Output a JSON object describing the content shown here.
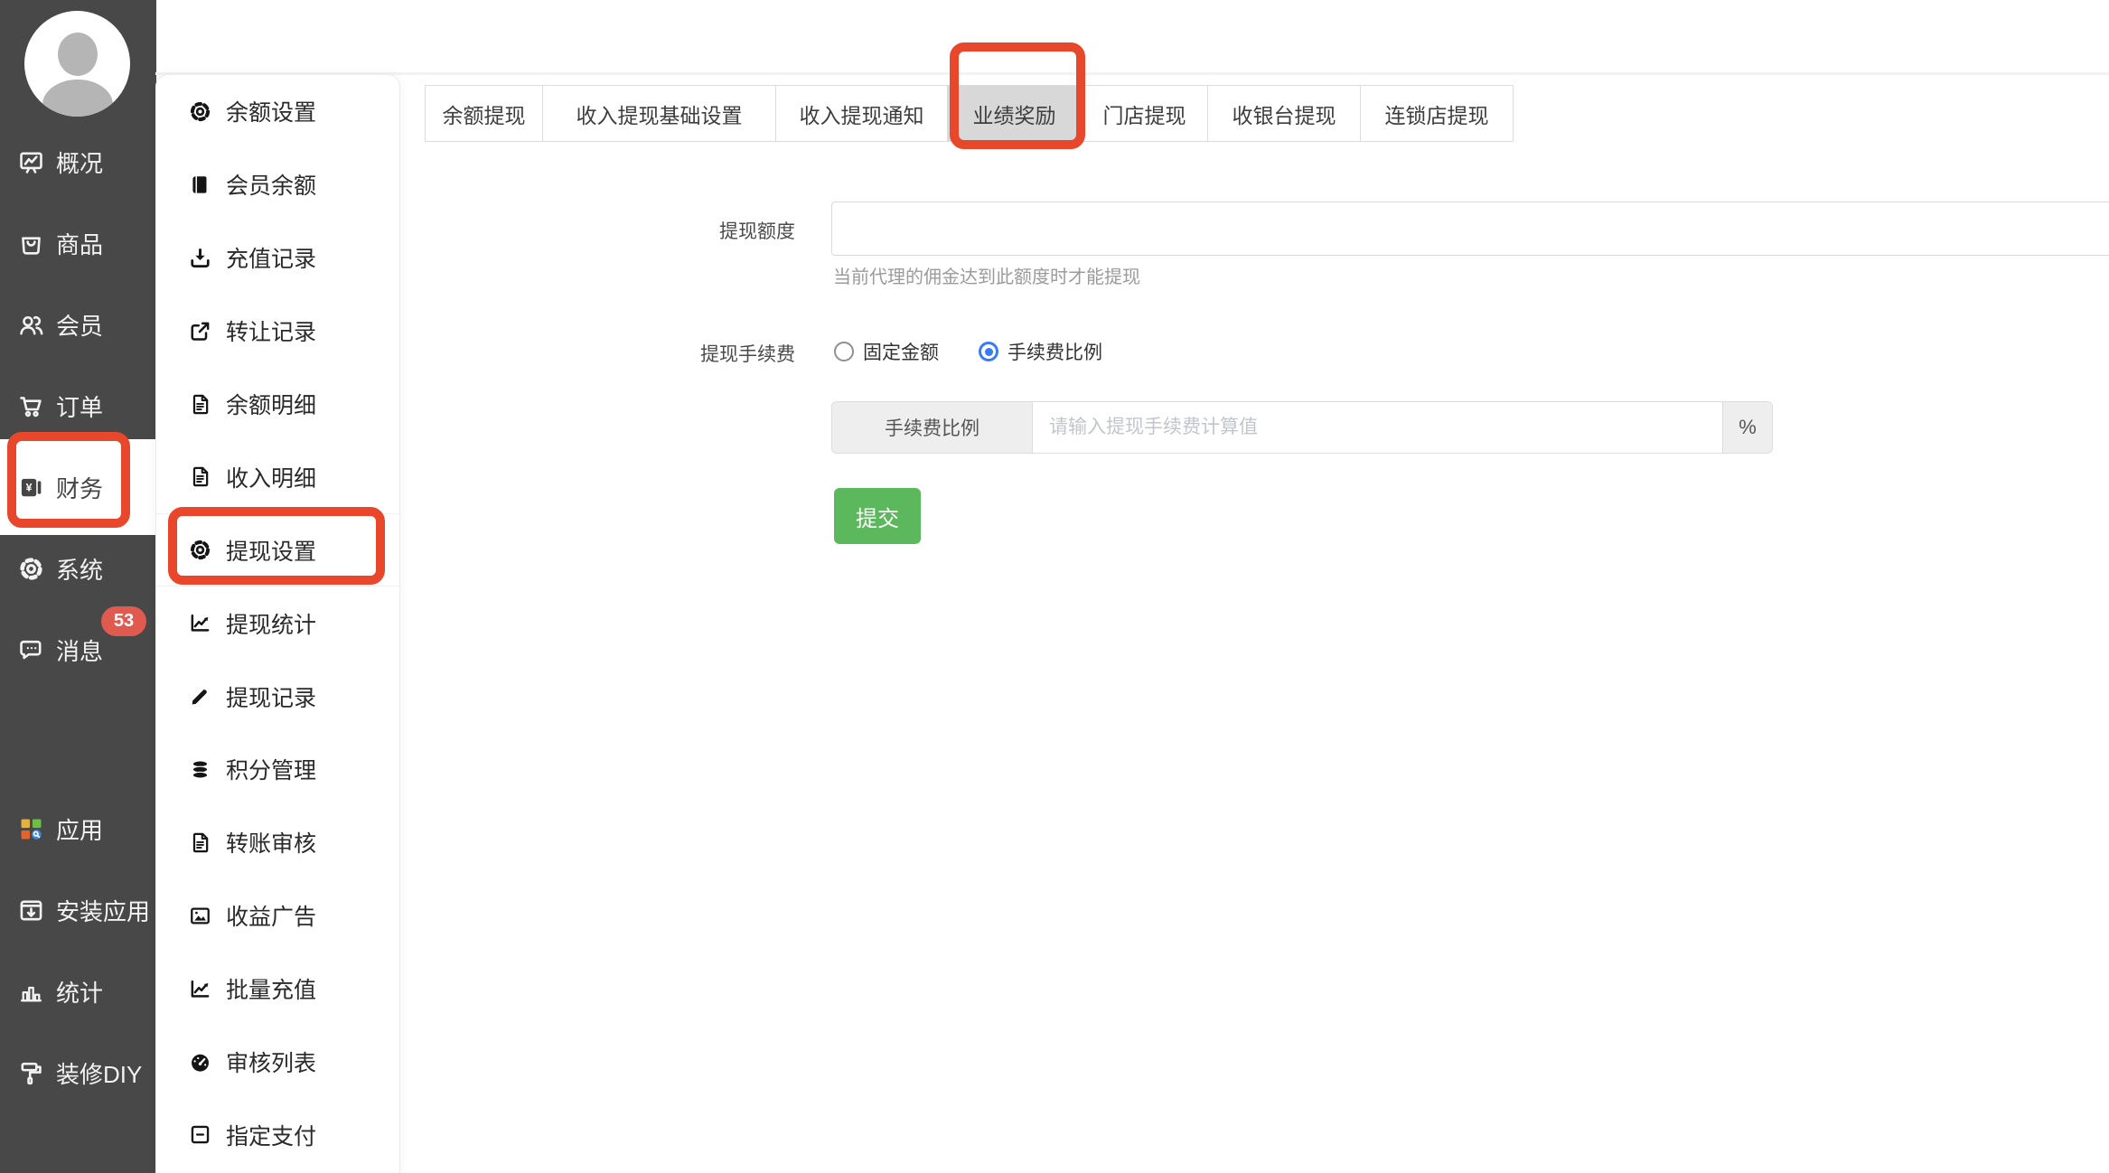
{
  "colors": {
    "sidebar-bg": "#484848",
    "sidebar-selected-bg": "#ffffff",
    "annotation": "#e8472b",
    "badge-bg": "#e15a50",
    "active-tab-bg": "#d8d8d8",
    "radio-blue": "#3a7af8",
    "submit-green": "#5cb85c"
  },
  "sidebar": {
    "items": [
      {
        "key": "overview",
        "label": "概况",
        "icon": "monitor"
      },
      {
        "key": "goods",
        "label": "商品",
        "icon": "bag"
      },
      {
        "key": "members",
        "label": "会员",
        "icon": "users"
      },
      {
        "key": "orders",
        "label": "订单",
        "icon": "cart"
      },
      {
        "key": "finance",
        "label": "财务",
        "icon": "wallet",
        "selected": true
      },
      {
        "key": "system",
        "label": "系统",
        "icon": "gear"
      },
      {
        "key": "messages",
        "label": "消息",
        "icon": "chat",
        "badge": "53"
      },
      {
        "key": "apps",
        "label": "应用",
        "icon": "grid",
        "group": 2
      },
      {
        "key": "install-apps",
        "label": "安装应用",
        "icon": "install",
        "group": 2
      },
      {
        "key": "statistics",
        "label": "统计",
        "icon": "bars",
        "group": 2
      },
      {
        "key": "decorate-diy",
        "label": "装修DIY",
        "icon": "roller",
        "group": 2
      }
    ],
    "messages_badge": "53"
  },
  "submenu": {
    "items": [
      {
        "key": "balance-settings",
        "label": "余额设置",
        "icon": "gear"
      },
      {
        "key": "member-balance",
        "label": "会员余额",
        "icon": "book"
      },
      {
        "key": "recharge-records",
        "label": "充值记录",
        "icon": "download"
      },
      {
        "key": "transfer-records",
        "label": "转让记录",
        "icon": "external"
      },
      {
        "key": "balance-detail",
        "label": "余额明细",
        "icon": "file"
      },
      {
        "key": "income-detail",
        "label": "收入明细",
        "icon": "file"
      },
      {
        "key": "withdraw-settings",
        "label": "提现设置",
        "icon": "gear",
        "highlighted": true
      },
      {
        "key": "withdraw-stats",
        "label": "提现统计",
        "icon": "chart"
      },
      {
        "key": "withdraw-records",
        "label": "提现记录",
        "icon": "pencil"
      },
      {
        "key": "points-management",
        "label": "积分管理",
        "icon": "database"
      },
      {
        "key": "transfer-audit",
        "label": "转账审核",
        "icon": "file"
      },
      {
        "key": "revenue-ads",
        "label": "收益广告",
        "icon": "image"
      },
      {
        "key": "batch-recharge",
        "label": "批量充值",
        "icon": "chart"
      },
      {
        "key": "audit-list",
        "label": "审核列表",
        "icon": "gauge"
      },
      {
        "key": "designated-payment",
        "label": "指定支付",
        "icon": "minus-square"
      }
    ]
  },
  "tabs": {
    "items": [
      {
        "key": "balance-withdraw",
        "label": "余额提现"
      },
      {
        "key": "income-withdraw-basic",
        "label": "收入提现基础设置"
      },
      {
        "key": "income-withdraw-notice",
        "label": "收入提现通知"
      },
      {
        "key": "performance-reward",
        "label": "业绩奖励",
        "active": true
      },
      {
        "key": "store-withdraw",
        "label": "门店提现"
      },
      {
        "key": "cashier-withdraw",
        "label": "收银台提现"
      },
      {
        "key": "chain-store-withdraw",
        "label": "连锁店提现"
      }
    ]
  },
  "form": {
    "quota": {
      "label": "提现额度",
      "value": "",
      "helper": "当前代理的佣金达到此额度时才能提现"
    },
    "fee": {
      "label": "提现手续费",
      "options": [
        {
          "label": "固定金额",
          "checked": false
        },
        {
          "label": "手续费比例",
          "checked": true
        }
      ]
    },
    "fee_rate": {
      "addon": "手续费比例",
      "value": "",
      "placeholder": "请输入提现手续费计算值",
      "suffix": "%"
    },
    "submit_label": "提交"
  }
}
